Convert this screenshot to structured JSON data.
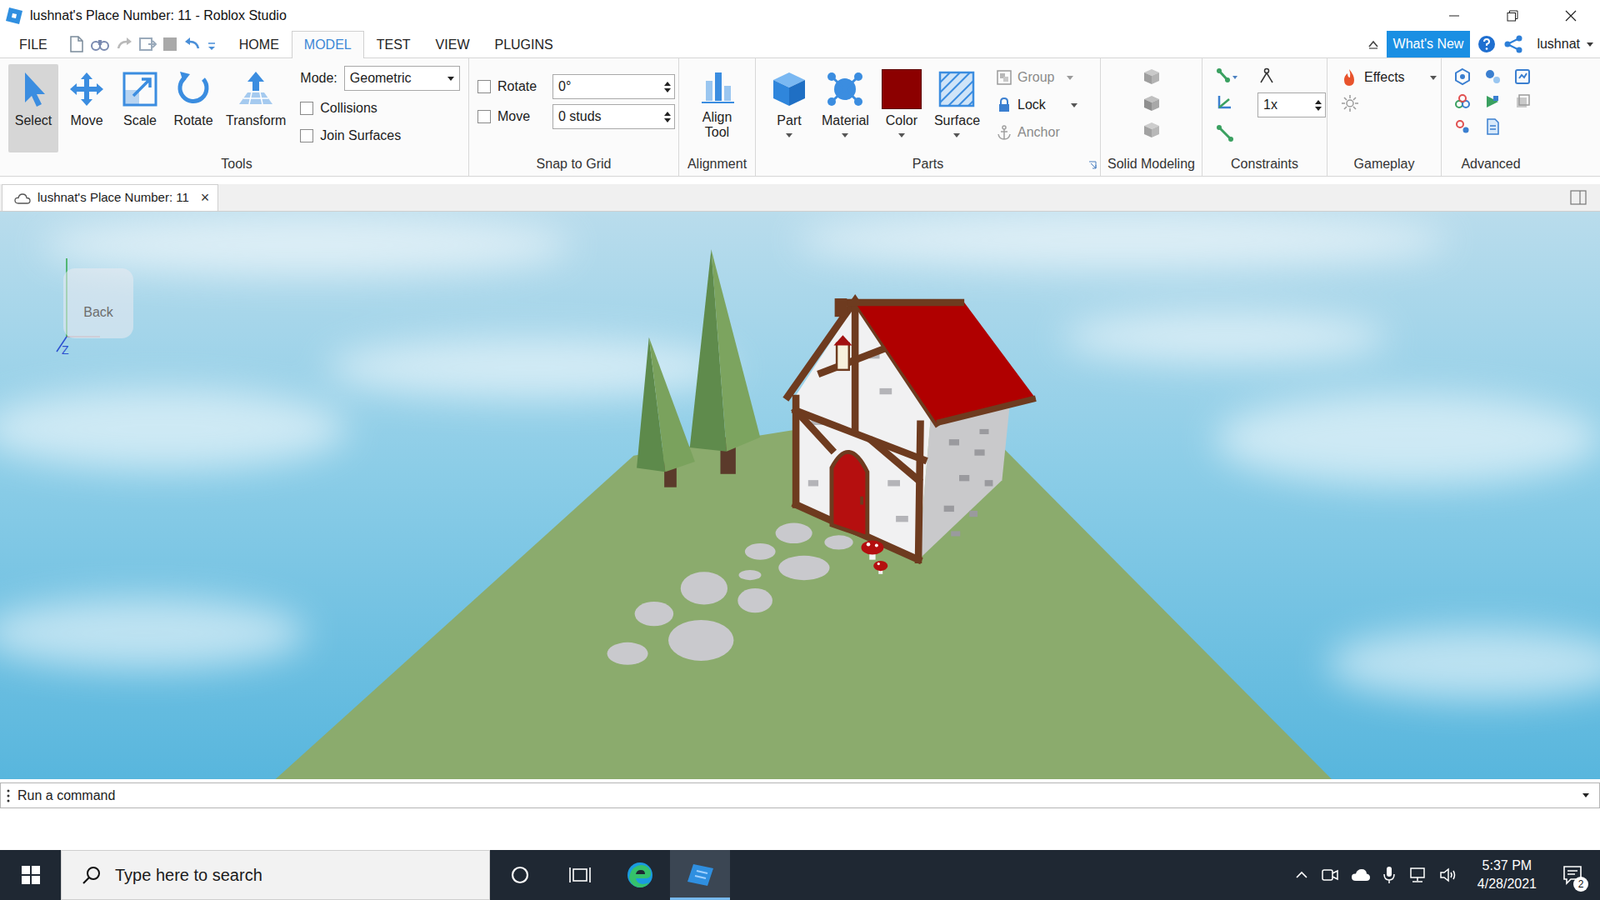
{
  "window": {
    "title": "lushnat's Place Number: 11 - Roblox Studio"
  },
  "menu_tabs": [
    {
      "label": "FILE",
      "selected": false
    },
    {
      "label": "HOME",
      "selected": false
    },
    {
      "label": "MODEL",
      "selected": true
    },
    {
      "label": "TEST",
      "selected": false
    },
    {
      "label": "VIEW",
      "selected": false
    },
    {
      "label": "PLUGINS",
      "selected": false
    }
  ],
  "account": {
    "whats_new": "What's New",
    "user": "lushnat"
  },
  "ribbon": {
    "tools": {
      "label": "Tools",
      "buttons": [
        {
          "label": "Select",
          "selected": true
        },
        {
          "label": "Move",
          "selected": false
        },
        {
          "label": "Scale",
          "selected": false
        },
        {
          "label": "Rotate",
          "selected": false
        },
        {
          "label": "Transform",
          "selected": false
        }
      ],
      "mode": {
        "label": "Mode:",
        "value": "Geometric"
      },
      "options": [
        {
          "label": "Collisions",
          "checked": false
        },
        {
          "label": "Join Surfaces",
          "checked": false
        }
      ]
    },
    "snap": {
      "label": "Snap to Grid",
      "rows": [
        {
          "label": "Rotate",
          "checked": false,
          "value": "0°"
        },
        {
          "label": "Move",
          "checked": false,
          "value": "0 studs"
        }
      ]
    },
    "alignment": {
      "label": "Alignment",
      "button": "Align Tool"
    },
    "parts": {
      "label": "Parts",
      "buttons": [
        "Part",
        "Material",
        "Color",
        "Surface"
      ],
      "color_swatch": "#8c0000",
      "actions": [
        {
          "label": "Group",
          "disabled": true
        },
        {
          "label": "Lock",
          "disabled": false
        },
        {
          "label": "Anchor",
          "disabled": true
        }
      ]
    },
    "solid_modeling": {
      "label": "Solid Modeling"
    },
    "constraints": {
      "label": "Constraints",
      "scale": "1x"
    },
    "gameplay": {
      "label": "Gameplay",
      "effects": "Effects"
    },
    "advanced": {
      "label": "Advanced"
    }
  },
  "document_tabs": [
    {
      "label": "lushnat's Place Number: 11",
      "selected": true,
      "close": "×"
    }
  ],
  "viewport": {
    "view_cube": {
      "face": "Back",
      "axis": "Z"
    }
  },
  "command_bar": {
    "placeholder": "Run a command"
  },
  "taskbar": {
    "search_placeholder": "Type here to search",
    "time": "5:37 PM",
    "date": "4/28/2021",
    "notifications": "2"
  }
}
